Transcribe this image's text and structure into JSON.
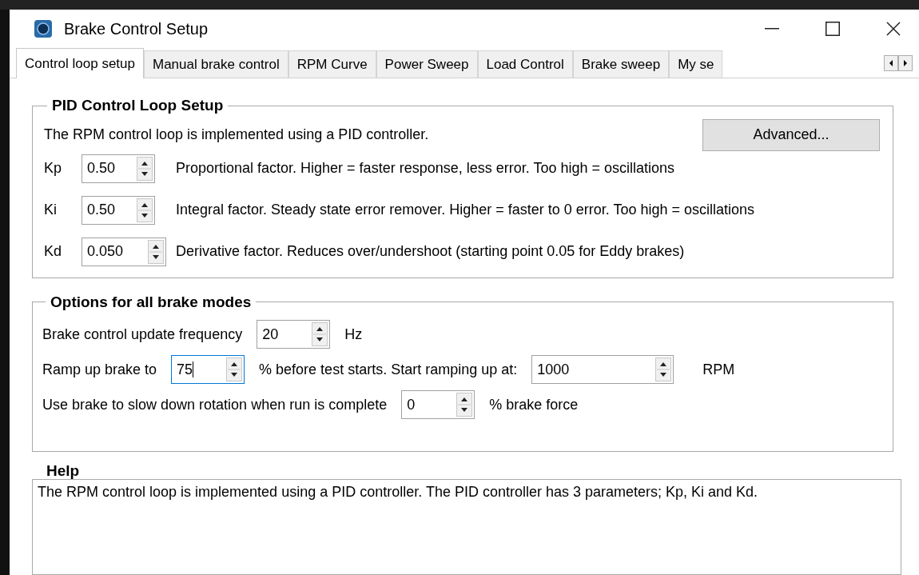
{
  "window": {
    "title": "Brake Control Setup"
  },
  "tabs": [
    {
      "label": "Control loop setup",
      "selected": true
    },
    {
      "label": "Manual brake control",
      "selected": false
    },
    {
      "label": "RPM Curve",
      "selected": false
    },
    {
      "label": "Power Sweep",
      "selected": false
    },
    {
      "label": "Load Control",
      "selected": false
    },
    {
      "label": "Brake sweep",
      "selected": false
    },
    {
      "label": "My se",
      "selected": false
    }
  ],
  "pid_group": {
    "title": "PID Control Loop Setup",
    "intro": "The RPM control loop is implemented using a PID controller.",
    "advanced_button": "Advanced...",
    "rows": [
      {
        "label": "Kp",
        "value": "0.50",
        "description": "Proportional factor. Higher = faster response, less error. Too high = oscillations"
      },
      {
        "label": "Ki",
        "value": "0.50",
        "description": "Integral factor. Steady state error remover. Higher = faster to 0 error. Too high = oscillations"
      },
      {
        "label": "Kd",
        "value": "0.050",
        "description": "Derivative factor. Reduces over/undershoot (starting point 0.05 for Eddy brakes)"
      }
    ]
  },
  "options_group": {
    "title": "Options for all brake modes",
    "rows": [
      {
        "label": "Brake control update frequency",
        "spin": {
          "value": "20",
          "focused": false
        },
        "unit": "Hz"
      },
      {
        "label": "Ramp up brake to",
        "spin": {
          "value": "75",
          "focused": true
        },
        "unit": "% before test starts. Start ramping up at:",
        "second_spin": {
          "value": "1000",
          "focused": false
        },
        "second_unit": "RPM"
      },
      {
        "label": "Use brake to slow down rotation when run is complete",
        "spin": {
          "value": "0",
          "focused": false
        },
        "unit": "% brake force"
      }
    ]
  },
  "help": {
    "title": "Help",
    "text": "The RPM control loop is implemented using a PID controller. The PID controller has 3 parameters; Kp, Ki and Kd."
  }
}
